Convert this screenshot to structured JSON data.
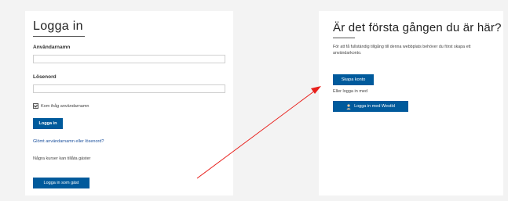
{
  "login": {
    "title": "Logga in",
    "username_label": "Användarnamn",
    "username_value": "",
    "password_label": "Lösenord",
    "password_value": "",
    "remember_label": "Kom ihåg användarnamn",
    "login_button": "Logga in",
    "forgot_link": "Glömt användarnamn eller lösenord?",
    "guest_text": "Några kurser kan tillåta gäster",
    "guest_button": "Logga in som gäst"
  },
  "first_time": {
    "title": "Är det första gången du är här?",
    "description": "För att få fullständig tillgång till denna webbplats behöver du först skapa ett användarkonto.",
    "create_button": "Skapa konto",
    "or_text": "Eller logga in med",
    "wsid_button": "Logga in med WestId",
    "wsid_icon": "person-icon"
  },
  "annotation": {
    "arrow_color": "#e8201c"
  }
}
